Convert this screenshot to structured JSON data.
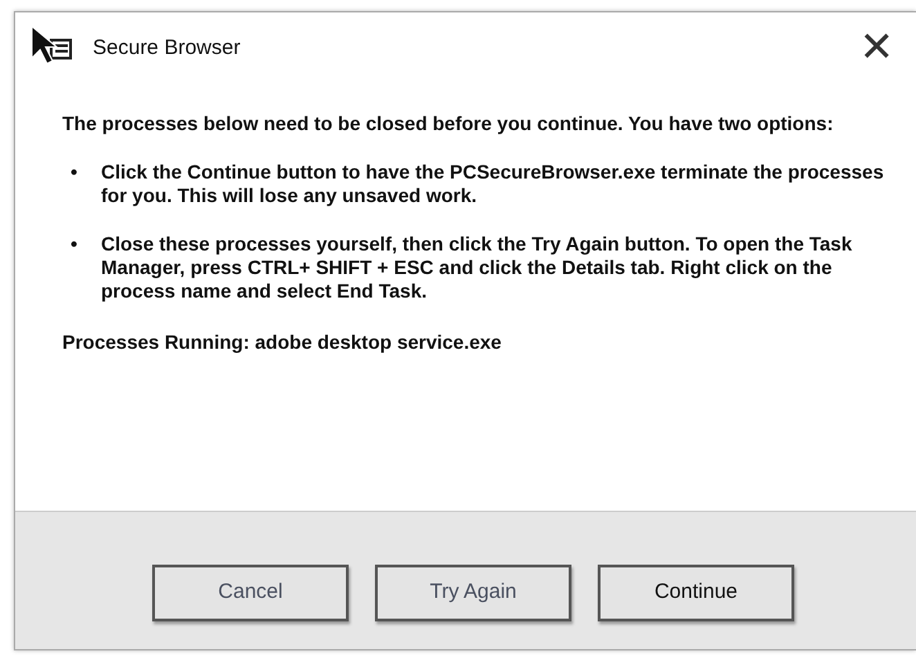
{
  "window": {
    "title": "Secure Browser",
    "close": "✕"
  },
  "intro": "The processes below need to be closed before you continue. You have two options:",
  "options": [
    {
      "bullet": "•",
      "text": "Click the Continue button to have the PCSecureBrowser.exe terminate the processes for you. This will lose any unsaved work."
    },
    {
      "bullet": "•",
      "text": "Close these processes yourself, then click the Try Again button. To open the Task Manager, press CTRL+ SHIFT + ESC and click the Details tab. Right click on the process name and select End Task."
    }
  ],
  "processes": "Processes Running: adobe desktop service.exe",
  "buttons": [
    {
      "label": "Cancel",
      "dim": true
    },
    {
      "label": "Try Again",
      "dim": true
    },
    {
      "label": "Continue",
      "dim": false
    }
  ]
}
